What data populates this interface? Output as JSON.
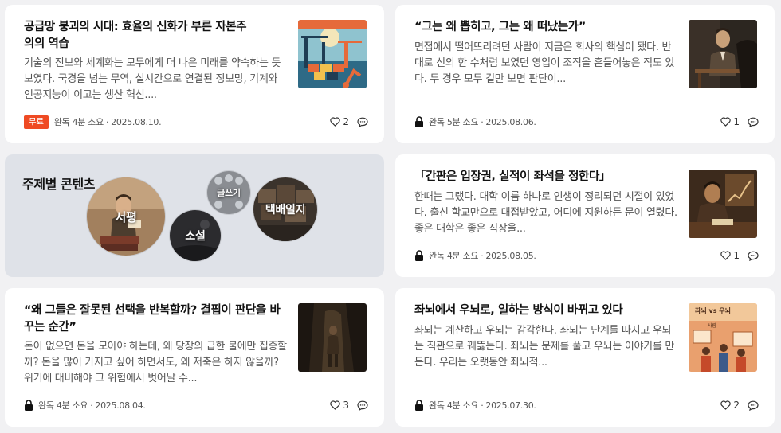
{
  "articles": [
    {
      "title": "공급망 붕괴의 시대: 효율의 신화가 부른 자본주의의 역습",
      "excerpt": "기술의 진보와 세계화는 모두에게 더 나은 미래를 약속하는 듯 보였다. 국경을 넘는 무역, 실시간으로 연결된 정보망, 기계와 인공지능이 이고는 생산 혁신....",
      "badge": "무료",
      "read_time": "완독 4분 소요",
      "date": "2025.08.10.",
      "likes": "2",
      "thumb_icon": "port-cranes-illustration"
    },
    {
      "title": "“그는 왜 뽑히고, 그는 왜 떠났는가”",
      "excerpt": "면접에서 떨어뜨리려던 사람이 지금은 회사의 핵심이 됐다. 반대로 신의 한 수처럼 보였던 영입이 조직을 흔들어놓은 적도 있다. 두 경우 모두 겉만 보면 판단이...",
      "read_time": "완독 5분 소요",
      "date": "2025.08.06.",
      "likes": "1",
      "thumb_icon": "man-at-desk-illustration"
    },
    {
      "title": "「간판은 입장권, 실적이 좌석을 정한다」",
      "excerpt": "한때는 그랬다. 대학 이름 하나로 인생이 정리되던 시절이 있었다. 출신 학교만으로 대접받았고, 어디에 지원하든 문이 열렸다. 좋은 대학은 좋은 직장을...",
      "read_time": "완독 4분 소요",
      "date": "2025.08.05.",
      "likes": "1",
      "thumb_icon": "man-writing-chart-illustration"
    },
    {
      "title": "“왜 그들은 잘못된 선택을 반복할까? 결핍이 판단을 바꾸는 순간”",
      "excerpt": "돈이 없으면 돈을 모아야 하는데, 왜 당장의 급한 불에만 집중할까? 돈을 많이 가지고 싶어 하면서도, 왜 저축은 하지 않을까? 위기에 대비해야 그 위험에서 벗어날 수...",
      "read_time": "완독 4분 소요",
      "date": "2025.08.04.",
      "likes": "3",
      "thumb_icon": "person-in-cave-illustration"
    },
    {
      "title": "좌뇌에서 우뇌로, 일하는 방식이 바뀌고 있다",
      "excerpt": "좌뇌는 계산하고 우뇌는 감각한다. 좌뇌는 단계를 따지고 우뇌는 직관으로 꿰뚫는다. 좌뇌는 문제를 풀고 우뇌는 이야기를 만든다. 우리는 오랫동안 좌뇌적...",
      "read_time": "완독 4분 소요",
      "date": "2025.07.30.",
      "likes": "2",
      "thumb_icon": "left-vs-right-brain-illustration",
      "thumb_text": "좌뇌 vs 우뇌",
      "thumb_subtext": "사람"
    }
  ],
  "topics": {
    "title": "주제별 콘텐츠",
    "items": [
      "서평",
      "소설",
      "글쓰기",
      "택배일지"
    ]
  },
  "colors": {
    "badge": "#ef4a23",
    "topic_card_bg": "#dfe2e8"
  }
}
